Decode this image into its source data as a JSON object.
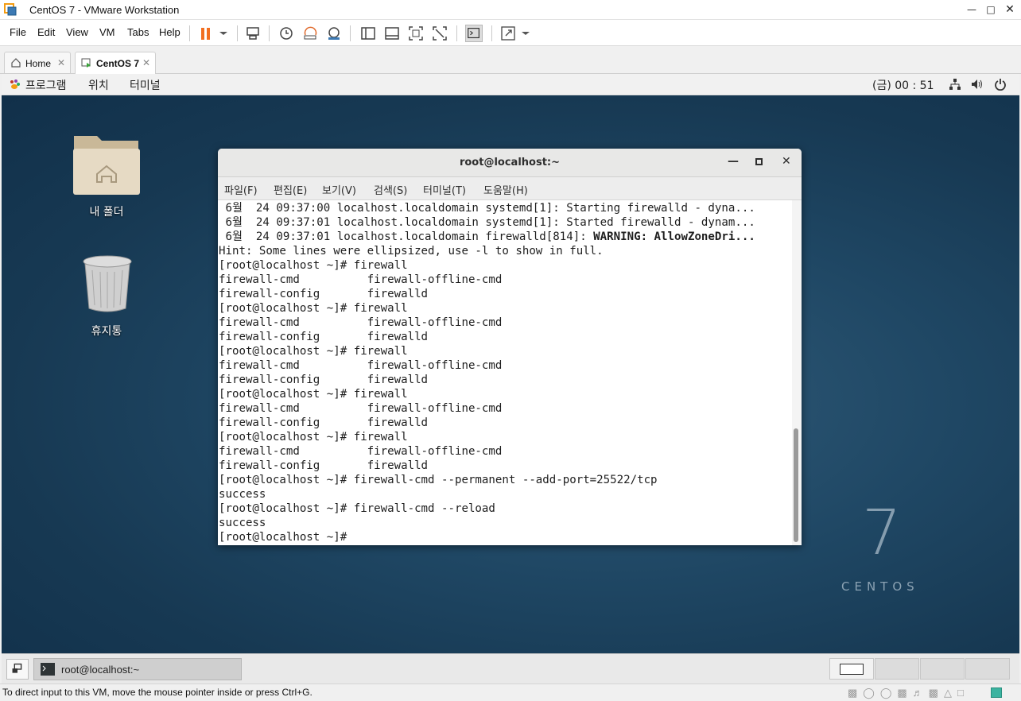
{
  "window": {
    "title": "CentOS 7 - VMware Workstation"
  },
  "menu": [
    "File",
    "Edit",
    "View",
    "VM",
    "Tabs",
    "Help"
  ],
  "tabs": [
    {
      "label": "Home",
      "active": false
    },
    {
      "label": "CentOS 7",
      "active": true
    }
  ],
  "gnome": {
    "apps_label": "프로그램",
    "places_label": "위치",
    "terminal_label": "터미널",
    "clock": "(금) 00 : 51"
  },
  "desktop": {
    "home_folder_label": "내 폴더",
    "trash_label": "휴지통",
    "brand_number": "7",
    "brand_text": "CENTOS"
  },
  "terminal": {
    "title": "root@localhost:~",
    "menu": [
      "파일(F)",
      "편집(E)",
      "보기(V)",
      "검색(S)",
      "터미널(T)",
      "도움말(H)"
    ],
    "lines": [
      {
        "text": " 6월  24 09:37:00 localhost.localdomain systemd[1]: Starting firewalld - dyna...",
        "bold": false
      },
      {
        "text": " 6월  24 09:37:01 localhost.localdomain systemd[1]: Started firewalld - dynam...",
        "bold": false
      },
      {
        "text": " 6월  24 09:37:01 localhost.localdomain firewalld[814]: ",
        "bold_tail": "WARNING: AllowZoneDri..."
      },
      {
        "text": "Hint: Some lines were ellipsized, use -l to show in full.",
        "bold": false
      },
      {
        "text": "[root@localhost ~]# firewall",
        "bold": false
      },
      {
        "text": "firewall-cmd          firewall-offline-cmd",
        "bold": false
      },
      {
        "text": "firewall-config       firewalld",
        "bold": false
      },
      {
        "text": "[root@localhost ~]# firewall",
        "bold": false
      },
      {
        "text": "firewall-cmd          firewall-offline-cmd",
        "bold": false
      },
      {
        "text": "firewall-config       firewalld",
        "bold": false
      },
      {
        "text": "[root@localhost ~]# firewall",
        "bold": false
      },
      {
        "text": "firewall-cmd          firewall-offline-cmd",
        "bold": false
      },
      {
        "text": "firewall-config       firewalld",
        "bold": false
      },
      {
        "text": "[root@localhost ~]# firewall",
        "bold": false
      },
      {
        "text": "firewall-cmd          firewall-offline-cmd",
        "bold": false
      },
      {
        "text": "firewall-config       firewalld",
        "bold": false
      },
      {
        "text": "[root@localhost ~]# firewall",
        "bold": false
      },
      {
        "text": "firewall-cmd          firewall-offline-cmd",
        "bold": false
      },
      {
        "text": "firewall-config       firewalld",
        "bold": false
      },
      {
        "text": "[root@localhost ~]# firewall-cmd --permanent --add-port=25522/tcp",
        "bold": false
      },
      {
        "text": "success",
        "bold": false
      },
      {
        "text": "[root@localhost ~]# firewall-cmd --reload",
        "bold": false
      },
      {
        "text": "success",
        "bold": false
      },
      {
        "text": "[root@localhost ~]#",
        "bold": false
      }
    ]
  },
  "taskbar": {
    "item_label": "root@localhost:~"
  },
  "statusbar": {
    "text": "To direct input to this VM, move the mouse pointer inside or press Ctrl+G."
  },
  "icons": [
    "vmware-logo-icon",
    "pause-icon",
    "send-ctrl-alt-del-icon",
    "snapshot-icon",
    "revert-snapshot-icon",
    "snapshot-manager-icon",
    "view-icons",
    "console-icon",
    "fullscreen-icon",
    "home-icon",
    "vm-tab-icon",
    "gnome-foot-icon",
    "network-icon",
    "volume-icon",
    "power-icon",
    "folder-icon",
    "trash-icon",
    "terminal-icon"
  ],
  "colors": {
    "desktop": "#1f4764",
    "pause_accent": "#f26f21"
  }
}
